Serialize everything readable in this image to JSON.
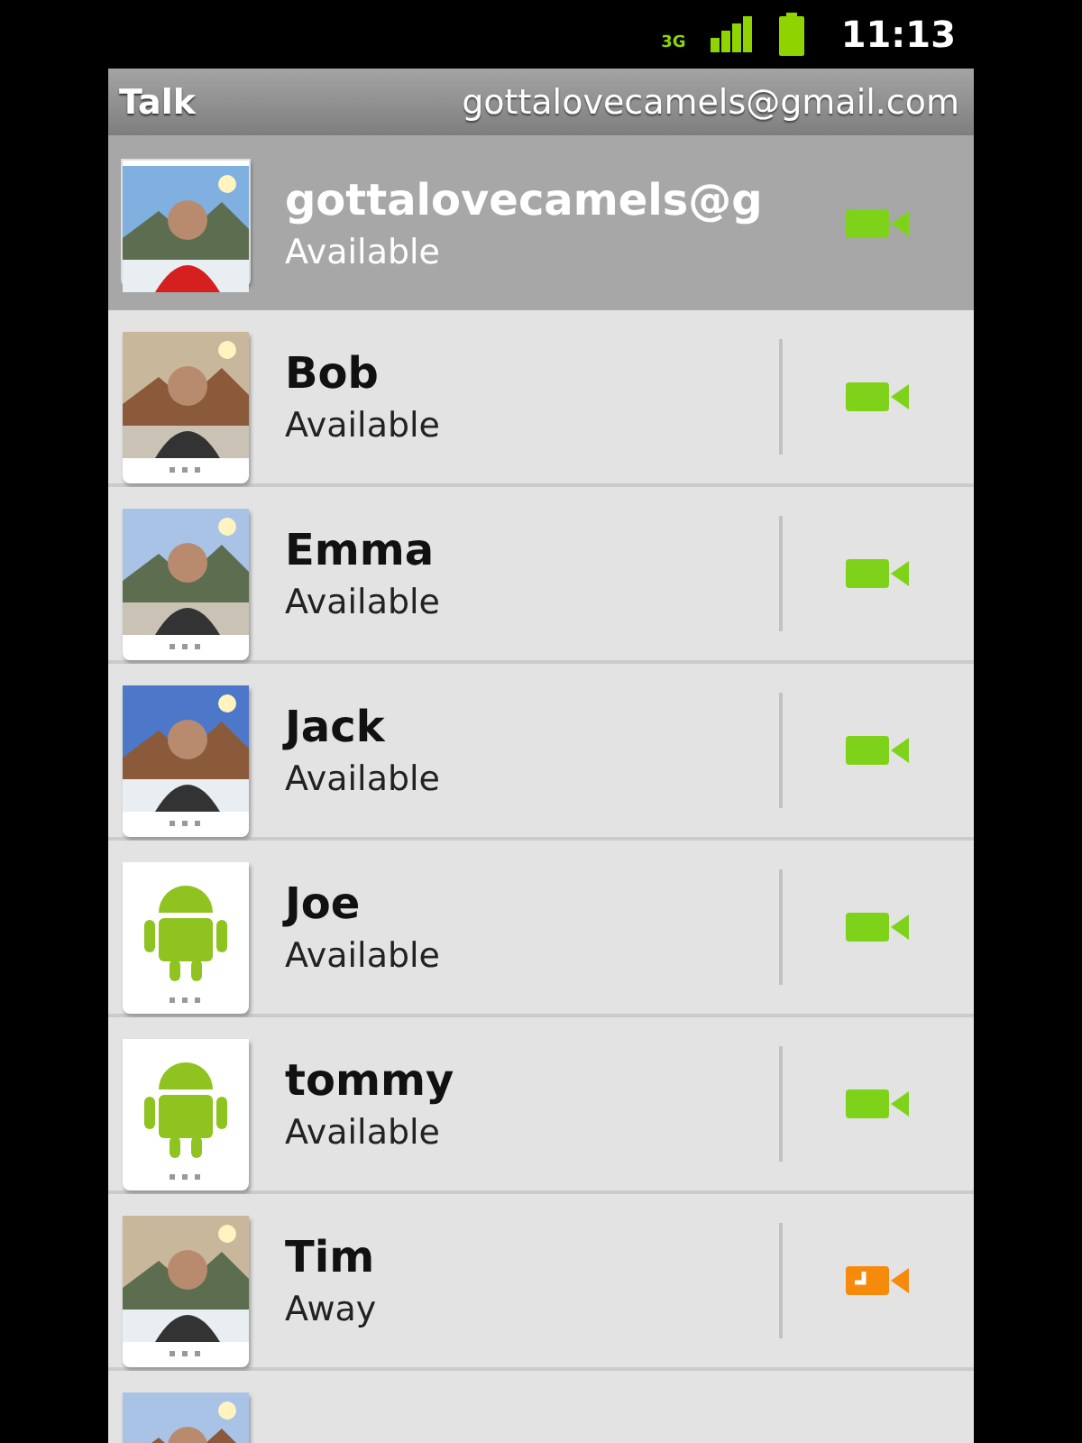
{
  "status_bar": {
    "network": "3G",
    "time": "11:13"
  },
  "app_bar": {
    "title": "Talk",
    "account": "gottalovecamels@gmail.com"
  },
  "self": {
    "name": "gottalovecamels@g",
    "status": "Available",
    "away": false,
    "avatar": {
      "kind": "picture"
    }
  },
  "contacts": [
    {
      "name": "Bob",
      "status": "Available",
      "away": false,
      "avatar": {
        "kind": "picture"
      }
    },
    {
      "name": "Emma",
      "status": "Available",
      "away": false,
      "avatar": {
        "kind": "picture"
      }
    },
    {
      "name": "Jack",
      "status": "Available",
      "away": false,
      "avatar": {
        "kind": "picture"
      }
    },
    {
      "name": "Joe",
      "status": "Available",
      "away": false,
      "avatar": {
        "kind": "robot"
      }
    },
    {
      "name": "tommy",
      "status": "Available",
      "away": false,
      "avatar": {
        "kind": "robot"
      }
    },
    {
      "name": "Tim",
      "status": "Away",
      "away": true,
      "avatar": {
        "kind": "picture"
      }
    },
    {
      "avatar": {
        "kind": "picture"
      }
    }
  ]
}
